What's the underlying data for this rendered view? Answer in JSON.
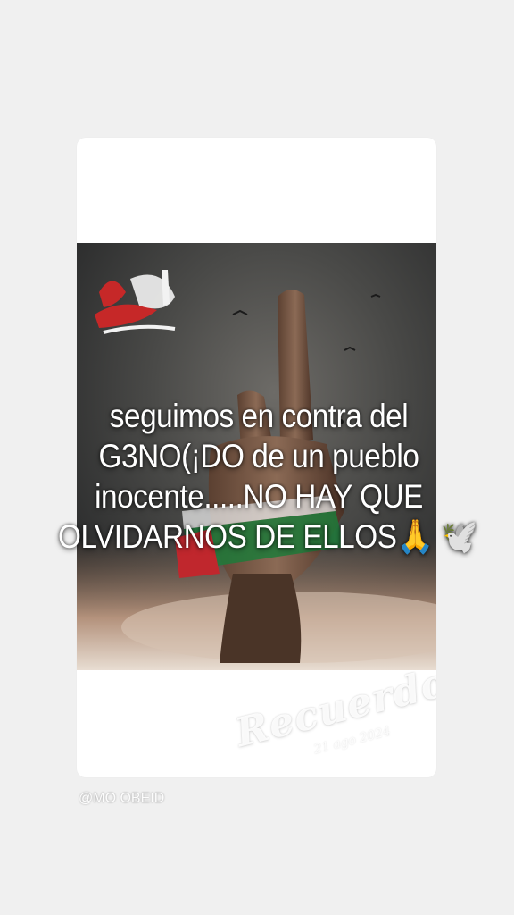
{
  "story": {
    "caption_lines": [
      "seguimos en contra del",
      "G3NO(¡DO de un pueblo",
      "inocente.....NO HAY QUE",
      "OLVIDARNOS DE ELLOS🙏 🕊️"
    ],
    "memories_label": "Recuerdos",
    "memories_date": "21 ago 2024",
    "creator_handle": "@MO OBEID",
    "photo_logo_icon": "arabic-calligraphy-logo"
  },
  "colors": {
    "page_background": "#f0f0f0",
    "card_background": "#ffffff",
    "sky_dark": "#2f3030",
    "flag_red": "#c0272d",
    "flag_green": "#1f7a3a"
  }
}
